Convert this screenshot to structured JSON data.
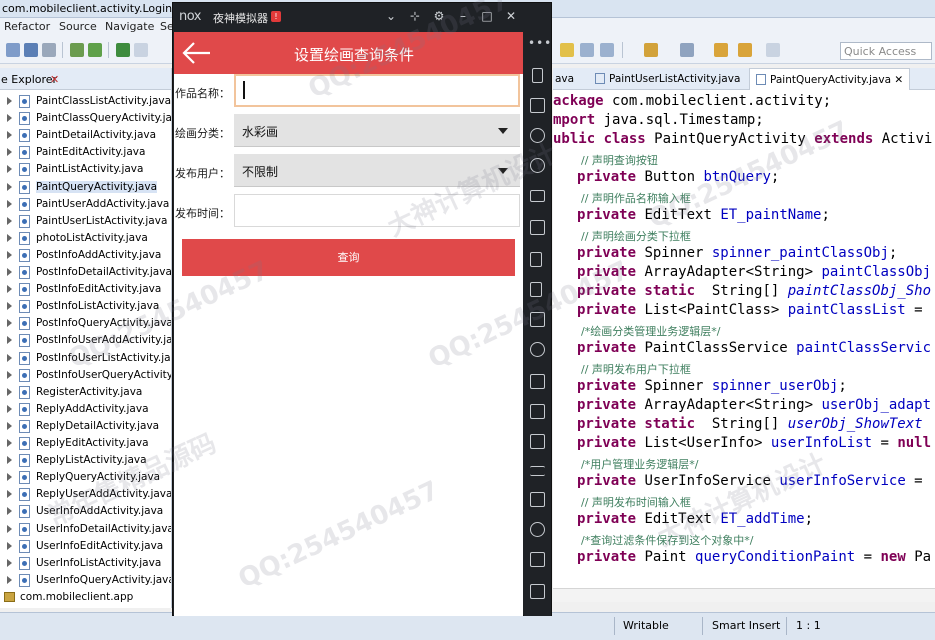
{
  "ide": {
    "title": "com.mobileclient.activity.LoginActivit",
    "menu": [
      "Refactor",
      "Source",
      "Navigate",
      "Se"
    ],
    "quick_access": "Quick Access",
    "package_explorer_tab": "e Explorer",
    "package_explorer_close": "✕",
    "files": [
      "PaintClassListActivity.java",
      "PaintClassQueryActivity.java",
      "PaintDetailActivity.java",
      "PaintEditActivity.java",
      "PaintListActivity.java",
      "PaintQueryActivity.java",
      "PaintUserAddActivity.java",
      "PaintUserListActivity.java",
      "photoListActivity.java",
      "PostInfoAddActivity.java",
      "PostInfoDetailActivity.java",
      "PostInfoEditActivity.java",
      "PostInfoListActivity.java",
      "PostInfoQueryActivity.java",
      "PostInfoUserAddActivity.java",
      "PostInfoUserListActivity.java",
      "PostInfoUserQueryActivity.ja",
      "RegisterActivity.java",
      "ReplyAddActivity.java",
      "ReplyDetailActivity.java",
      "ReplyEditActivity.java",
      "ReplyListActivity.java",
      "ReplyQueryActivity.java",
      "ReplyUserAddActivity.java",
      "UserInfoAddActivity.java",
      "UserInfoDetailActivity.java",
      "UserInfoEditActivity.java",
      "UserInfoListActivity.java",
      "UserInfoQueryActivity.java"
    ],
    "selected_file_index": 5,
    "package_row": "com.mobileclient.app",
    "editor_tabs": [
      "ava",
      "PaintUserListActivity.java",
      "PaintQueryActivity.java"
    ],
    "editor_tab_close": "✕",
    "code": {
      "l1_kw": "ackage",
      "l1_rest": " com.mobileclient.activity;",
      "l2_kw": "mport",
      "l2_rest": " java.sql.Timestamp;",
      "l3_kw": "ublic class",
      "l3_mid": " PaintQueryActivity ",
      "l3_kw2": "extends",
      "l3_rest": " Activi",
      "c1": "// 声明查询按钮",
      "l4_kw": "private",
      "l4_type": " Button ",
      "l4_fld": "btnQuery",
      "l4_end": ";",
      "c2": "// 声明作品名称输入框",
      "l5_kw": "private",
      "l5_type": " EditText ",
      "l5_fld": "ET_paintName",
      "l5_end": ";",
      "c3": "// 声明绘画分类下拉框",
      "l6_kw": "private",
      "l6_type": " Spinner ",
      "l6_fld": "spinner_paintClassObj",
      "l6_end": ";",
      "l7_kw": "private",
      "l7_type": " ArrayAdapter<String> ",
      "l7_fld": "paintClassObj",
      "l8_kw": "private static",
      "l8_type": "  String[] ",
      "l8_fld": "paintClassObj_Sho",
      "l9_kw": "private",
      "l9_type": " List<PaintClass> ",
      "l9_fld": "paintClassList",
      "l9_end": " =",
      "c4": "/*绘画分类管理业务逻辑层*/",
      "l10_kw": "private",
      "l10_type": " PaintClassService ",
      "l10_fld": "paintClassServic",
      "c5": "// 声明发布用户下拉框",
      "l11_kw": "private",
      "l11_type": " Spinner ",
      "l11_fld": "spinner_userObj",
      "l11_end": ";",
      "l12_kw": "private",
      "l12_type": " ArrayAdapter<String> ",
      "l12_fld": "userObj_adapt",
      "l13_kw": "private static",
      "l13_type": "  String[] ",
      "l13_fld": "userObj_ShowText",
      "l14_kw": "private",
      "l14_type": " List<UserInfo> ",
      "l14_fld": "userInfoList",
      "l14_end": " = ",
      "l14_kw2": "null",
      "c6": "/*用户管理业务逻辑层*/",
      "l15_kw": "private",
      "l15_type": " UserInfoService ",
      "l15_fld": "userInfoService",
      "l15_end": " =",
      "c7": "// 声明发布时间输入框",
      "l16_kw": "private",
      "l16_type": " EditText ",
      "l16_fld": "ET_addTime",
      "l16_end": ";",
      "c8": "/*查询过滤条件保存到这个对象中*/",
      "l17_kw": "private",
      "l17_type": " Paint ",
      "l17_fld": "queryConditionPaint",
      "l17_end": " = ",
      "l17_kw2": "new",
      "l17_rest": " Pa"
    },
    "status": {
      "writable": "Writable",
      "insert_mode": "Smart Insert",
      "position": "1 : 1"
    }
  },
  "emulator": {
    "logo": "nox",
    "name": "夜神模拟器",
    "badge": "!",
    "controls": [
      "⌄",
      "⊹",
      "⚙",
      "–",
      "□",
      "✕"
    ],
    "sidebar_dots": "•••"
  },
  "app": {
    "title": "设置绘画查询条件",
    "fields": {
      "paint_name_label": "作品名称：",
      "paint_name_value": "",
      "category_label": "绘画分类：",
      "category_value": "水彩画",
      "user_label": "发布用户：",
      "user_value": "不限制",
      "time_label": "发布时间：",
      "time_value": ""
    },
    "query_button": "查询"
  },
  "watermarks": [
    "QQ:254540457",
    "大神计算机设计",
    "常年售精品源码"
  ],
  "colors": {
    "app_header": "#e0494a",
    "query_button": "#e0494a",
    "emulator_frame": "#1f2226",
    "focus_border": "#f2c49c"
  }
}
